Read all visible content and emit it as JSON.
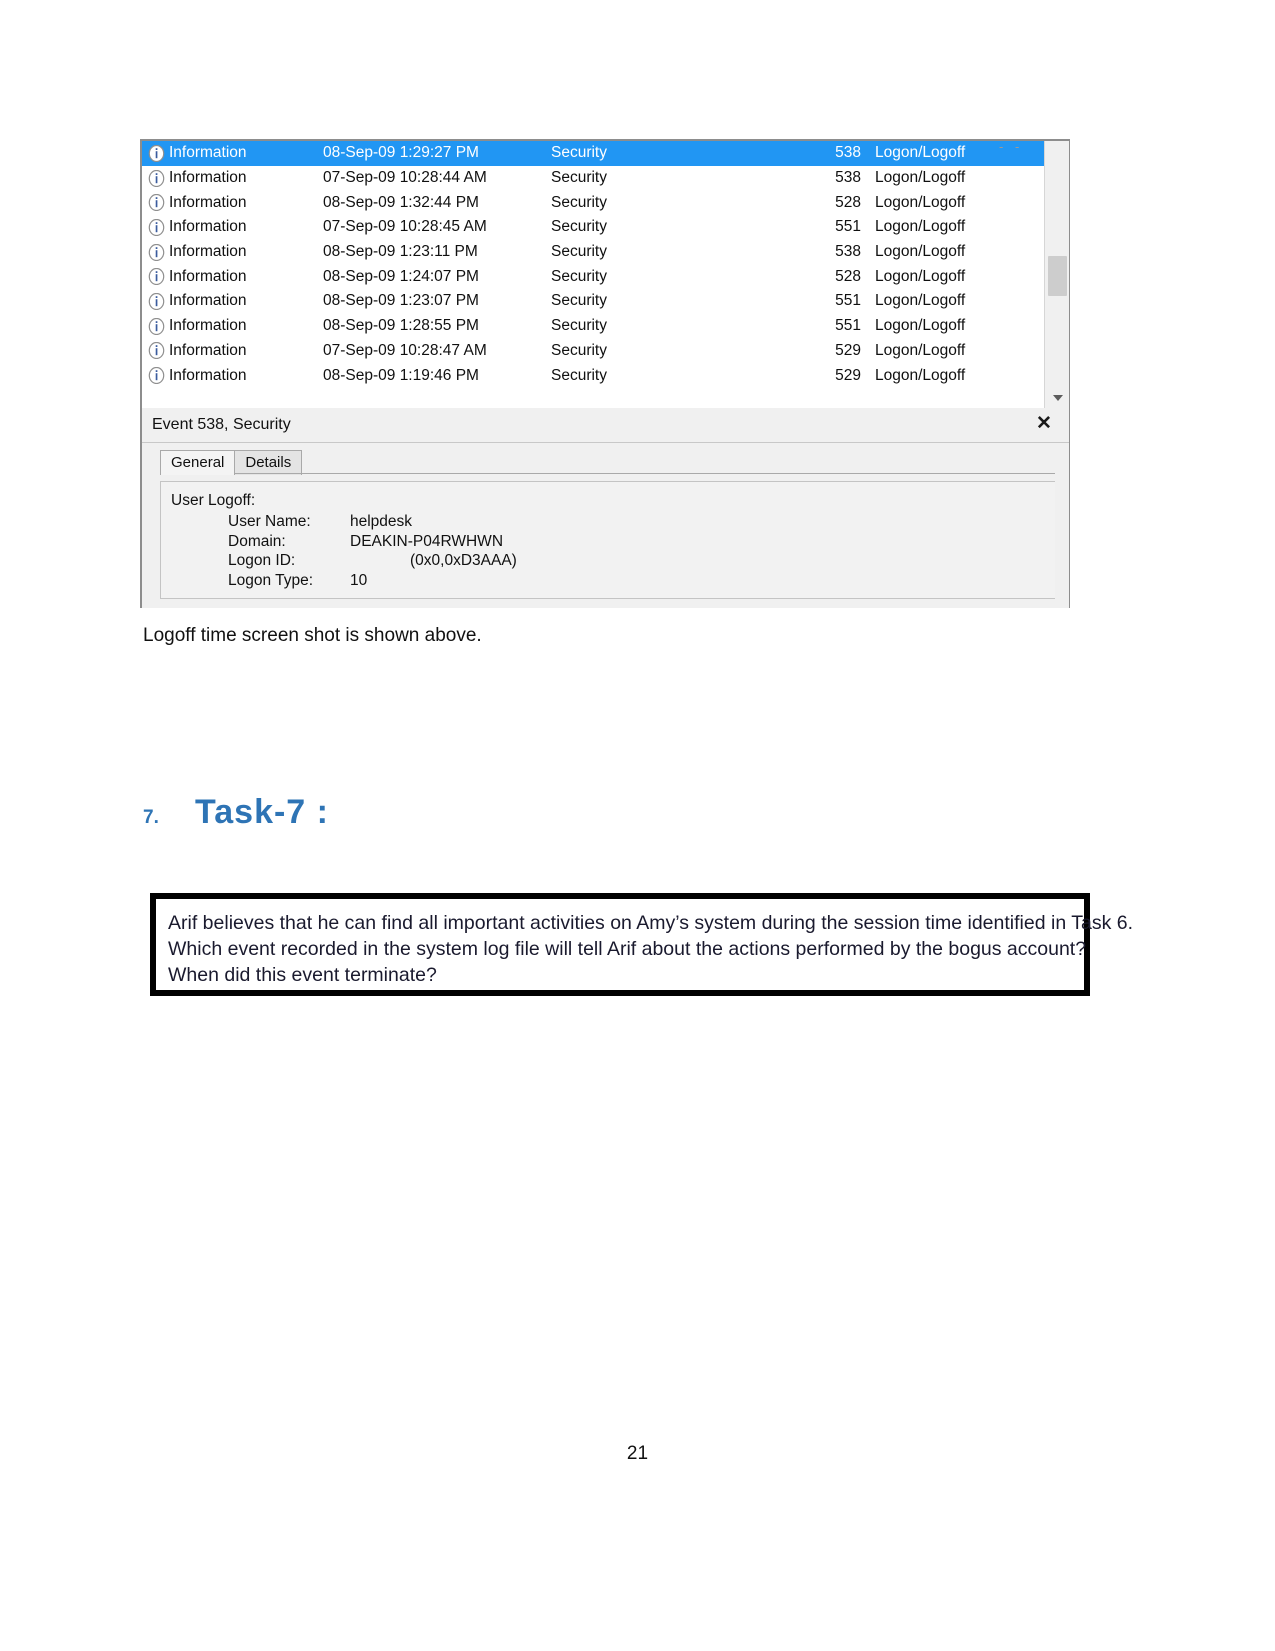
{
  "document": {
    "page_number": "21",
    "caption": "Logoff time screen shot is shown above.",
    "heading": {
      "number": "7.",
      "text": "Task-7 :"
    },
    "question_box": {
      "lines": [
        "Arif believes that he can find all important activities on Amy’s system during the session time identified in Task 6.",
        "Which event recorded in the system log file will tell Arif about the actions performed by the bogus account?",
        "When did this event terminate?"
      ]
    }
  },
  "event_viewer": {
    "list": {
      "rows": [
        {
          "icon": "information-icon",
          "level": "Information",
          "date": "08-Sep-09 1:29:27 PM",
          "source": "Security",
          "event_id": "538",
          "category": "Logon/Logoff",
          "selected": true
        },
        {
          "icon": "information-icon",
          "level": "Information",
          "date": "07-Sep-09 10:28:44 AM",
          "source": "Security",
          "event_id": "538",
          "category": "Logon/Logoff",
          "selected": false
        },
        {
          "icon": "information-icon",
          "level": "Information",
          "date": "08-Sep-09 1:32:44 PM",
          "source": "Security",
          "event_id": "528",
          "category": "Logon/Logoff",
          "selected": false
        },
        {
          "icon": "information-icon",
          "level": "Information",
          "date": "07-Sep-09 10:28:45 AM",
          "source": "Security",
          "event_id": "551",
          "category": "Logon/Logoff",
          "selected": false
        },
        {
          "icon": "information-icon",
          "level": "Information",
          "date": "08-Sep-09 1:23:11 PM",
          "source": "Security",
          "event_id": "538",
          "category": "Logon/Logoff",
          "selected": false
        },
        {
          "icon": "information-icon",
          "level": "Information",
          "date": "08-Sep-09 1:24:07 PM",
          "source": "Security",
          "event_id": "528",
          "category": "Logon/Logoff",
          "selected": false
        },
        {
          "icon": "information-icon",
          "level": "Information",
          "date": "08-Sep-09 1:23:07 PM",
          "source": "Security",
          "event_id": "551",
          "category": "Logon/Logoff",
          "selected": false
        },
        {
          "icon": "information-icon",
          "level": "Information",
          "date": "08-Sep-09 1:28:55 PM",
          "source": "Security",
          "event_id": "551",
          "category": "Logon/Logoff",
          "selected": false
        },
        {
          "icon": "information-icon",
          "level": "Information",
          "date": "07-Sep-09 10:28:47 AM",
          "source": "Security",
          "event_id": "529",
          "category": "Logon/Logoff",
          "selected": false
        },
        {
          "icon": "information-icon",
          "level": "Information",
          "date": "08-Sep-09 1:19:46 PM",
          "source": "Security",
          "event_id": "529",
          "category": "Logon/Logoff",
          "selected": false
        }
      ]
    },
    "detail": {
      "title": "Event 538, Security",
      "close_label": "✕",
      "tabs": [
        {
          "label": "General",
          "active": true
        },
        {
          "label": "Details",
          "active": false
        }
      ],
      "body_title": "User Logoff:",
      "fields": [
        {
          "key": "User Name:",
          "value": "helpdesk",
          "indented": false
        },
        {
          "key": "Domain:",
          "value": "DEAKIN-P04RWHWN",
          "indented": false
        },
        {
          "key": "Logon ID:",
          "value": "(0x0,0xD3AAA)",
          "indented": true
        },
        {
          "key": "Logon Type:",
          "value": "10",
          "indented": false
        }
      ]
    }
  },
  "colors": {
    "selection_blue": "#2196f3",
    "heading_blue": "#2e74b5",
    "box_border": "#000000"
  }
}
